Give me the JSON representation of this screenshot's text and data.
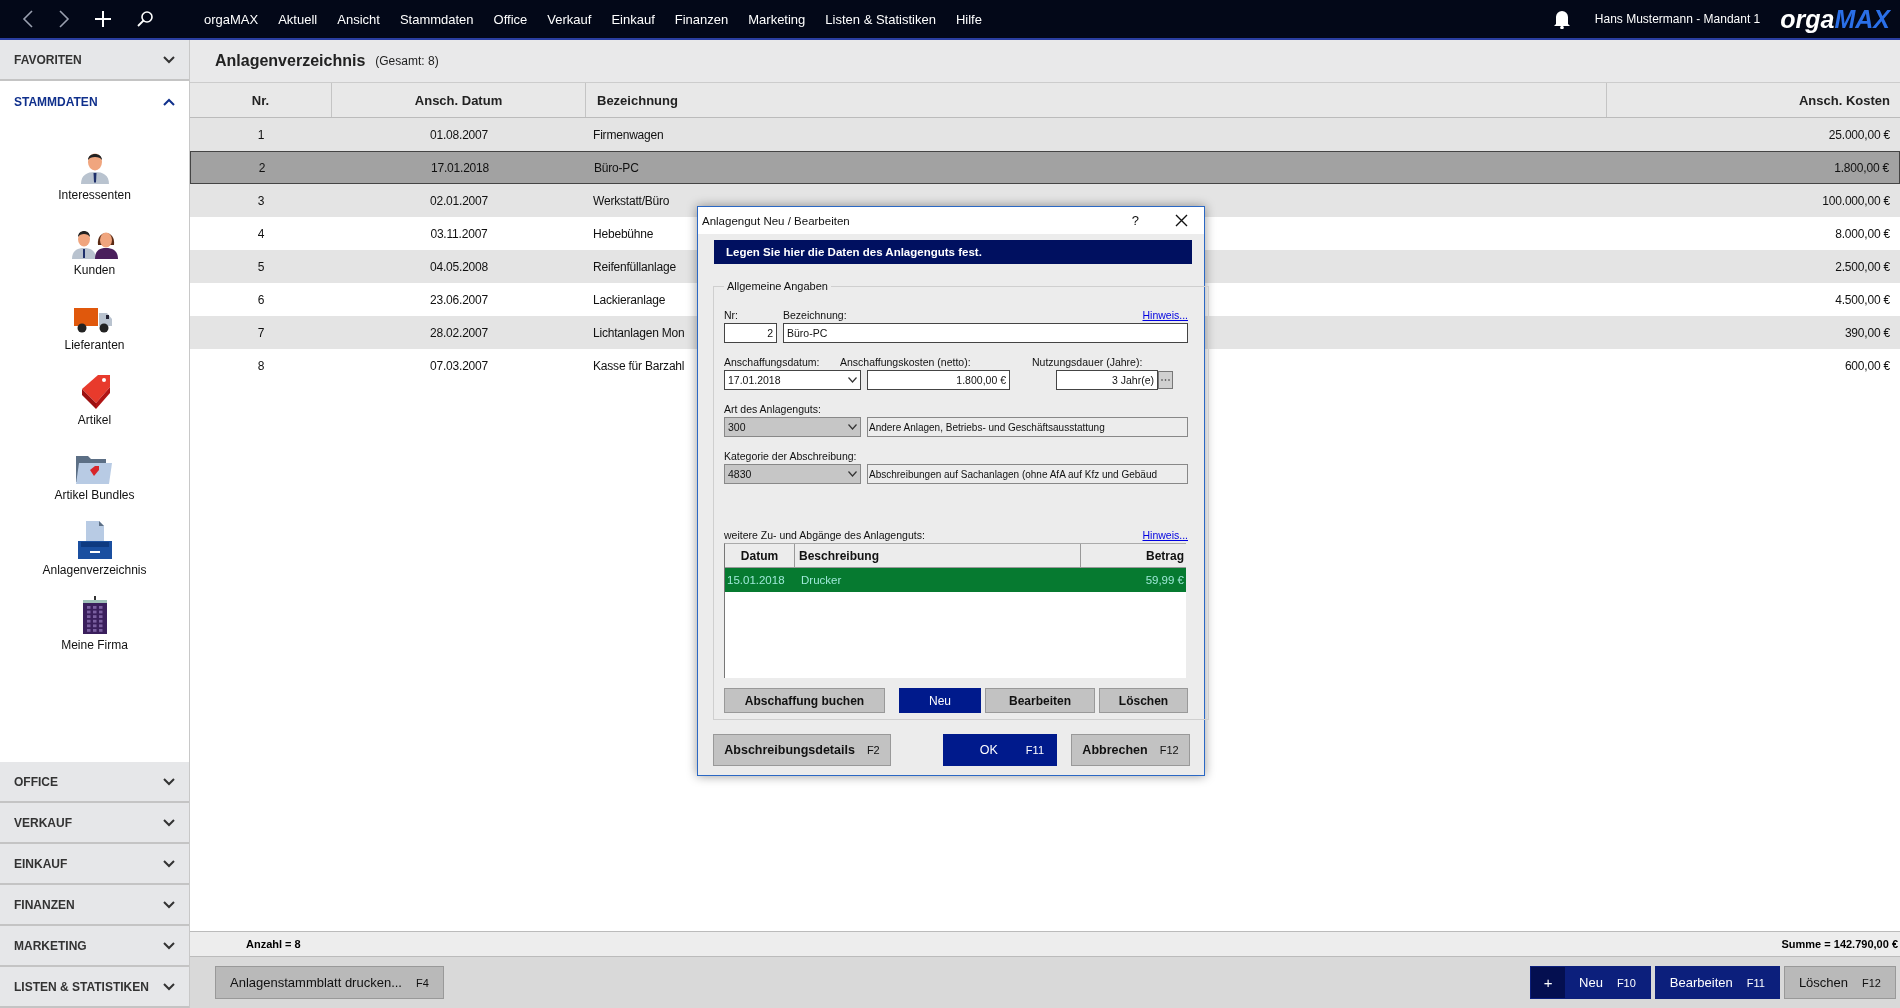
{
  "top_bar": {
    "menu": [
      {
        "label": "orgaMAX"
      },
      {
        "label": "Aktuell"
      },
      {
        "label": "Ansicht"
      },
      {
        "label": "Stammdaten"
      },
      {
        "label": "Office"
      },
      {
        "label": "Verkauf"
      },
      {
        "label": "Einkauf"
      },
      {
        "label": "Finanzen"
      },
      {
        "label": "Marketing"
      },
      {
        "label": "Listen & Statistiken"
      },
      {
        "label": "Hilfe"
      }
    ],
    "user": "Hans Mustermann - Mandant 1",
    "logo": {
      "part_1": "orga",
      "part_2": "MAX"
    }
  },
  "sidebar": {
    "sections": [
      {
        "label": "FAVORITEN",
        "expanded": false
      },
      {
        "label": "STAMMDATEN",
        "expanded": true,
        "items": [
          {
            "label": "Interessenten"
          },
          {
            "label": "Kunden"
          },
          {
            "label": "Lieferanten"
          },
          {
            "label": "Artikel"
          },
          {
            "label": "Artikel Bundles"
          },
          {
            "label": "Anlagenverzeichnis"
          },
          {
            "label": "Meine Firma"
          }
        ]
      }
    ],
    "bottom_sections": [
      {
        "label": "OFFICE",
        "expanded": false
      },
      {
        "label": "VERKAUF",
        "expanded": false
      },
      {
        "label": "EINKAUF",
        "expanded": false
      },
      {
        "label": "FINANZEN",
        "expanded": false
      },
      {
        "label": "MARKETING",
        "expanded": false
      },
      {
        "label": "LISTEN & STATISTIKEN",
        "expanded": false
      }
    ]
  },
  "page": {
    "title": "Anlagenverzeichnis",
    "total": "(Gesamt: 8)"
  },
  "table": {
    "columns": [
      "Nr.",
      "Ansch. Datum",
      "Bezeichnung",
      "Ansch. Kosten"
    ],
    "rows": [
      {
        "cells": [
          "1",
          "01.08.2007",
          "Firmenwagen",
          "25.000,00 €"
        ],
        "selected": false
      },
      {
        "cells": [
          "2",
          "17.01.2018",
          "Büro-PC",
          "1.800,00 €"
        ],
        "selected": true
      },
      {
        "cells": [
          "3",
          "02.01.2007",
          "Werkstatt/Büro",
          "100.000,00 €"
        ],
        "selected": false
      },
      {
        "cells": [
          "4",
          "03.11.2007",
          "Hebebühne",
          "8.000,00 €"
        ],
        "selected": false
      },
      {
        "cells": [
          "5",
          "04.05.2008",
          "Reifenfüllanlage",
          "2.500,00 €"
        ],
        "selected": false
      },
      {
        "cells": [
          "6",
          "23.06.2007",
          "Lackieranlage",
          "4.500,00 €"
        ],
        "selected": false
      },
      {
        "cells": [
          "7",
          "28.02.2007",
          "Lichtanlagen Mon",
          "390,00 €"
        ],
        "selected": false
      },
      {
        "cells": [
          "8",
          "07.03.2007",
          "Kasse für Barzahl",
          "600,00 €"
        ],
        "selected": false
      }
    ]
  },
  "status_bar": {
    "count": "Anzahl = 8",
    "sum": "Summe = 142.790,00 €"
  },
  "actions": {
    "left": [
      {
        "label": "Anlagenstammblatt  drucken...",
        "key": "F4",
        "primary": false
      }
    ],
    "right": [
      {
        "prefix": "+",
        "label": "Neu",
        "key": "F10",
        "primary": true
      },
      {
        "label": "Bearbeiten",
        "key": "F11",
        "primary": true
      },
      {
        "label": "Löschen",
        "key": "F12",
        "primary": false
      }
    ]
  },
  "dialog": {
    "title": "Anlagengut Neu / Bearbeiten",
    "help": "?",
    "banner": "Legen Sie hier die Daten des Anlagenguts fest.",
    "group": "Allgemeine Angaben",
    "nr": {
      "label": "Nr:",
      "value": "2"
    },
    "name": {
      "label": "Bezeichnung:",
      "value": "Büro-PC"
    },
    "hint_link": "Hinweis...",
    "date": {
      "label": "Anschaffungsdatum:",
      "value": "17.01.2018"
    },
    "cost": {
      "label": "Anschaffungskosten (netto):",
      "value": "1.800,00 €"
    },
    "duration": {
      "label": "Nutzungsdauer (Jahre):",
      "value": "3 Jahr(e)"
    },
    "asset_type": {
      "label": "Art des Anlagenguts:",
      "code": "300",
      "description": "Andere Anlagen, Betriebs- und Geschäftsausstattung",
      "disabled": true
    },
    "category": {
      "label": "Kategorie der Abschreibung:",
      "code": "4830",
      "description": "Abschreibungen auf Sachanlagen (ohne AfA auf Kfz und Gebäud",
      "disabled": true
    },
    "movements": {
      "label": "weitere Zu- und Abgänge des Anlagenguts:",
      "hint_link": "Hinweis...",
      "columns": [
        "Datum",
        "Beschreibung",
        "Betrag"
      ],
      "rows": [
        {
          "cells": [
            "15.01.2018",
            "Drucker",
            "59,99 €"
          ],
          "selected": true
        }
      ],
      "buttons": [
        {
          "label": "Abschaffung buchen",
          "primary": false
        },
        {
          "label": "Neu",
          "primary": true
        },
        {
          "label": "Bearbeiten",
          "primary": false
        },
        {
          "label": "Löschen",
          "primary": false
        }
      ]
    },
    "footer_buttons": [
      {
        "label": "Abschreibungsdetails",
        "key": "F2",
        "primary": false
      },
      {
        "label": "OK",
        "key": "F11",
        "primary": true
      },
      {
        "label": "Abbrechen",
        "key": "F12",
        "primary": false
      }
    ]
  }
}
